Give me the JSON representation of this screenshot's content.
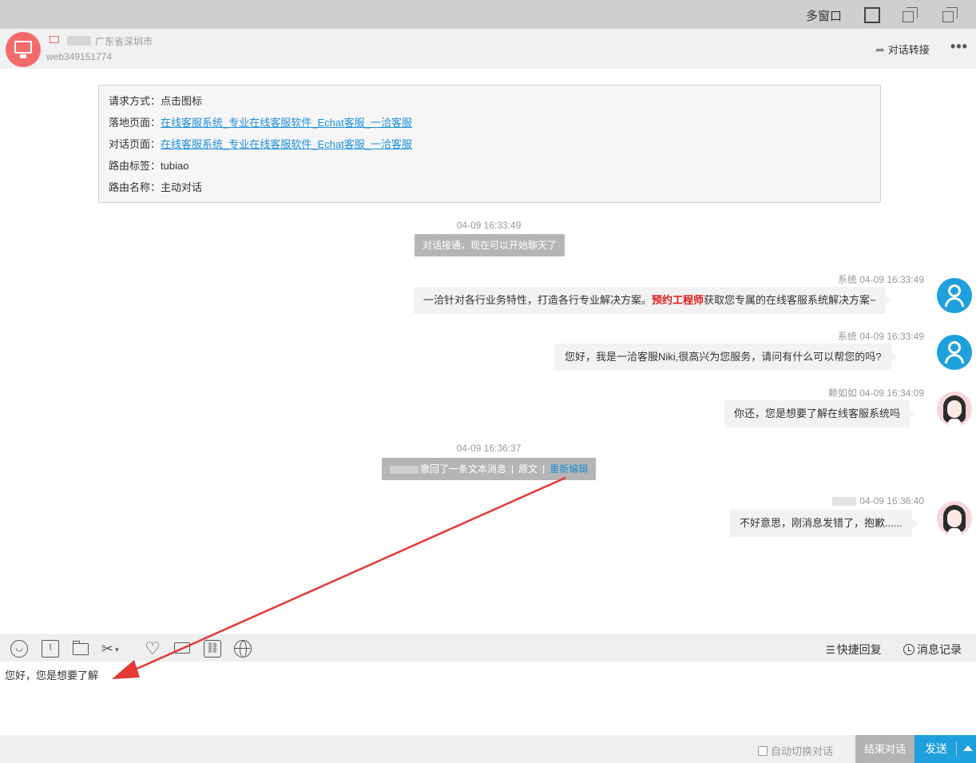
{
  "window": {
    "multi_window": "多窗口"
  },
  "visitor": {
    "location": "广东省深圳市",
    "id": "web349151774",
    "transfer": "对话转接",
    "more": "•••"
  },
  "info": [
    {
      "key": "请求方式：",
      "value": "点击图标",
      "link": false
    },
    {
      "key": "落地页面：",
      "value": "在线客服系统_专业在线客服软件_Echat客服_一洽客服",
      "link": true
    },
    {
      "key": "对话页面：",
      "value": "在线客服系统_专业在线客服软件_Echat客服_一洽客服",
      "link": true
    },
    {
      "key": "路由标签：",
      "value": "tubiao",
      "link": false
    },
    {
      "key": "路由名称：",
      "value": "主动对话",
      "link": false
    }
  ],
  "timeline": {
    "ts1": "04-09 16:33:49",
    "notice1": "对话接通，现在可以开始聊天了",
    "ts2": "04-09 16:36:37",
    "recall_text": "撤回了一条文本消息",
    "recall_original": "原文",
    "recall_reedit": "重新编辑",
    "recall_sep": "|"
  },
  "messages": [
    {
      "sender": "系统",
      "time": "04-09 16:33:49",
      "before": "一洽针对各行业务特性，打造各行专业解决方案。",
      "highlight": "预约工程师",
      "after": "获取您专属的在线客服系统解决方案~"
    },
    {
      "sender": "系统",
      "time": "04-09 16:33:49",
      "text": "您好，我是一洽客服Niki,很高兴为您服务，请问有什么可以帮您的吗?"
    },
    {
      "sender": "赖如如",
      "time": "04-09 16:34:09",
      "text": "你还，您是想要了解在线客服系统吗"
    },
    {
      "sender": "",
      "time": "04-09 16:36:40",
      "text": "不好意思，刚消息发错了，抱歉......"
    }
  ],
  "toolbar": {
    "quick_reply": "快捷回复",
    "history": "消息记录",
    "quick_icon": "☰",
    "dropdown_icon": "▾"
  },
  "input": {
    "value": "您好，您是想要了解"
  },
  "footer": {
    "auto_switch": "自动切换对话",
    "end": "结束对话",
    "send": "发送"
  },
  "colors": {
    "accent": "#1ea0dc",
    "highlight": "#e01a1a",
    "link": "#1e8fd8",
    "annotation_arrow": "#e53935"
  }
}
